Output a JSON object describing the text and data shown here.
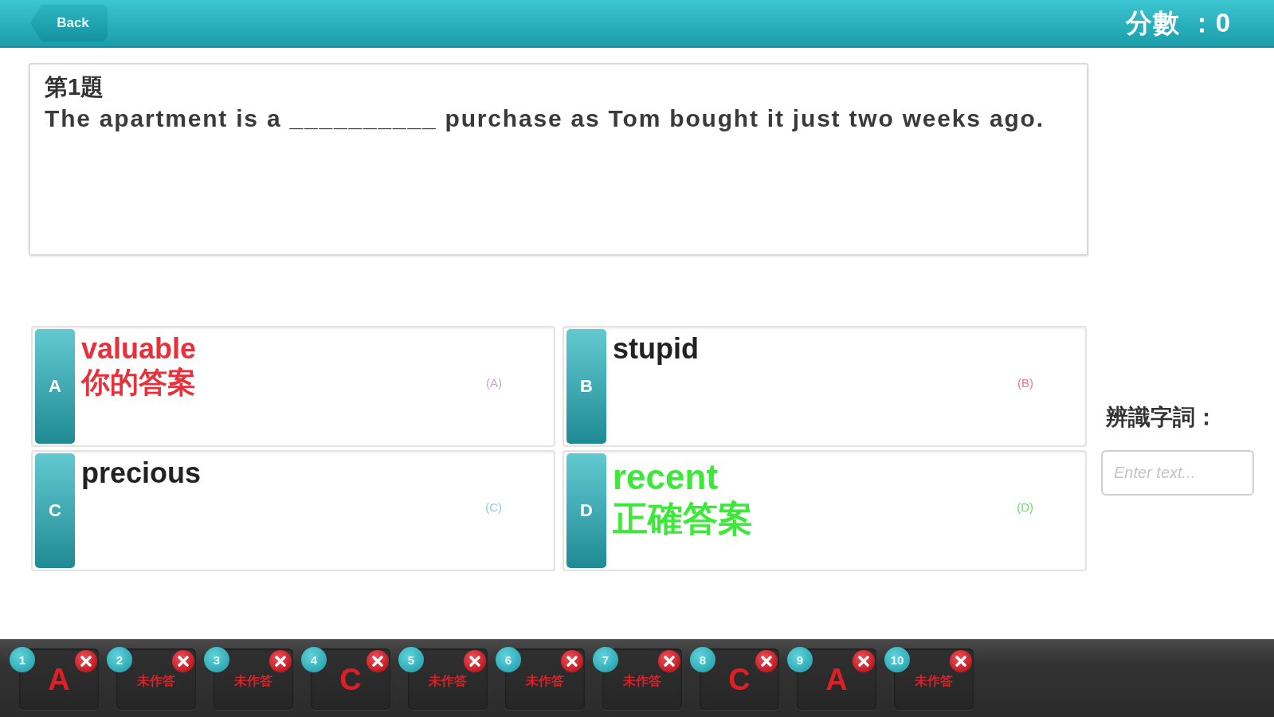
{
  "header": {
    "back": "Back",
    "score": "分數 ：0"
  },
  "question": {
    "number": "第1題",
    "text": "The apartment is a __________ purchase as Tom bought it just two weeks ago."
  },
  "options": [
    {
      "kind": "chosen",
      "letter": "A",
      "text": "valuable",
      "note": "你的答案",
      "tag": "(A)",
      "color": "#c8a2d6"
    },
    {
      "kind": "plain",
      "letter": "B",
      "text": "stupid",
      "tag": "(B)",
      "color": "#e8788a"
    },
    {
      "kind": "plain",
      "letter": "C",
      "text": "precious",
      "tag": "(C)",
      "color": "#8ccbe0"
    },
    {
      "kind": "correct",
      "letter": "D",
      "text": "recent",
      "note": "正確答案",
      "tag": "(D)",
      "color": "#6ed86e"
    }
  ],
  "recognition": {
    "label": "辨識字詞：",
    "placeholder": "Enter text..."
  },
  "answer_sheet": [
    {
      "number": "1",
      "answer": "A",
      "answered": true
    },
    {
      "number": "2",
      "answer": "未作答",
      "answered": false
    },
    {
      "number": "3",
      "answer": "未作答",
      "answered": false
    },
    {
      "number": "4",
      "answer": "C",
      "answered": true
    },
    {
      "number": "5",
      "answer": "未作答",
      "answered": false
    },
    {
      "number": "6",
      "answer": "未作答",
      "answered": false
    },
    {
      "number": "7",
      "answer": "未作答",
      "answered": false
    },
    {
      "number": "8",
      "answer": "C",
      "answered": true
    },
    {
      "number": "9",
      "answer": "A",
      "answered": true
    },
    {
      "number": "10",
      "answer": "未作答",
      "answered": false
    }
  ]
}
